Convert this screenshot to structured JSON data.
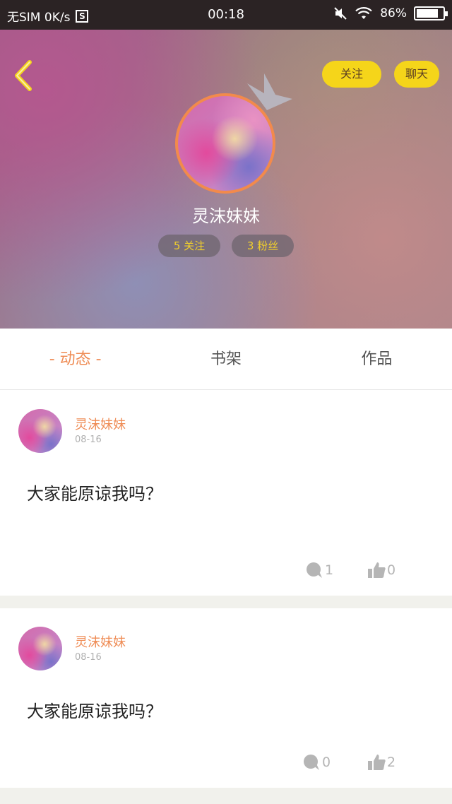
{
  "status_bar": {
    "carrier": "无SIM 0K/s",
    "s_badge": "S",
    "time": "00:18",
    "battery_text": "86%",
    "battery_level": 0.86
  },
  "header": {
    "follow_label": "关注",
    "chat_label": "聊天"
  },
  "profile": {
    "username": "灵沫妹妹",
    "following": "5 关注",
    "fans": "3 粉丝"
  },
  "tabs": [
    {
      "label": "- 动态 -",
      "active": true
    },
    {
      "label": "书架",
      "active": false
    },
    {
      "label": "作品",
      "active": false
    }
  ],
  "posts": [
    {
      "author": "灵沫妹妹",
      "date": "08-16",
      "content": "大家能原谅我吗？",
      "comments": "1",
      "likes": "0"
    },
    {
      "author": "灵沫妹妹",
      "date": "08-16",
      "content": "大家能原谅我吗？",
      "comments": "0",
      "likes": "2"
    }
  ],
  "colors": {
    "accent": "#ef8c55",
    "button_yellow": "#f5d51a",
    "avatar_border": "#f28a4c"
  }
}
